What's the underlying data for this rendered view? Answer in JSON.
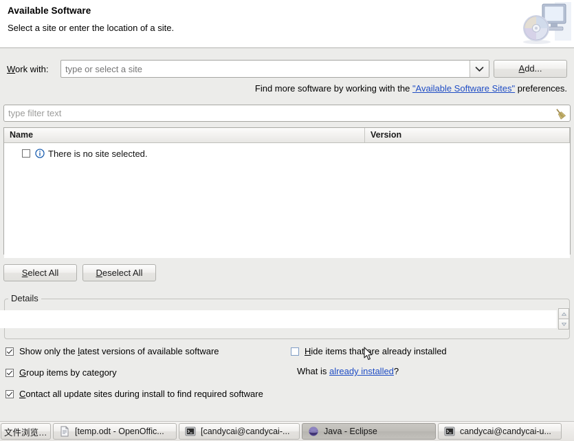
{
  "header": {
    "title": "Available Software",
    "subtitle": "Select a site or enter the location of a site.",
    "icon": "computer-cd-icon"
  },
  "work_with": {
    "label": "Work with:",
    "label_mnemonic": "W",
    "placeholder": "type or select a site",
    "value": "",
    "dropdown_icon": "chevron-down-icon",
    "add_button": "Add...",
    "add_button_mnemonic": "A"
  },
  "find_more": {
    "prefix": "Find more software by working with the ",
    "link": "\"Available Software Sites\"",
    "suffix": " preferences."
  },
  "filter": {
    "placeholder": "type filter text",
    "value": "",
    "clear_icon": "broom-icon"
  },
  "table": {
    "columns": [
      "Name",
      "Version"
    ],
    "rows": [
      {
        "checked": false,
        "icon": "info-icon",
        "name": "There is no site selected.",
        "version": ""
      }
    ]
  },
  "buttons": {
    "select_all": "Select All",
    "select_all_mnemonic": "S",
    "deselect_all": "Deselect All",
    "deselect_all_mnemonic": "D"
  },
  "details": {
    "legend": "Details",
    "text": "",
    "scroll_up_icon": "arrow-up-icon",
    "scroll_down_icon": "arrow-down-icon"
  },
  "options": [
    {
      "label": "Show only the latest versions of available software",
      "checked": true,
      "mnemonic": "l"
    },
    {
      "label": "Group items by category",
      "checked": true,
      "mnemonic": "G"
    },
    {
      "label": "Contact all update sites during install to find required software",
      "checked": true,
      "mnemonic": "C"
    },
    {
      "label": "Hide items that are already installed",
      "checked": false,
      "mnemonic": "H"
    }
  ],
  "what_is": {
    "prefix": "What is ",
    "link": "already installed",
    "suffix": "?"
  },
  "taskbar": [
    {
      "label": "文件浏览…",
      "icon": "none",
      "active": false
    },
    {
      "label": "[temp.odt - OpenOffic...",
      "icon": "document-icon",
      "active": false
    },
    {
      "label": "[candycai@candycai-...",
      "icon": "terminal-icon",
      "active": false
    },
    {
      "label": "Java - Eclipse",
      "icon": "eclipse-icon",
      "active": true
    },
    {
      "label": "candycai@candycai-u...",
      "icon": "terminal-icon",
      "active": false
    }
  ],
  "colors": {
    "dialog_bg": "#ececea",
    "banner_bg": "#ffffff",
    "link": "#1e4cc4",
    "field_bg": "#ffffff",
    "border": "#a6a6a2"
  }
}
